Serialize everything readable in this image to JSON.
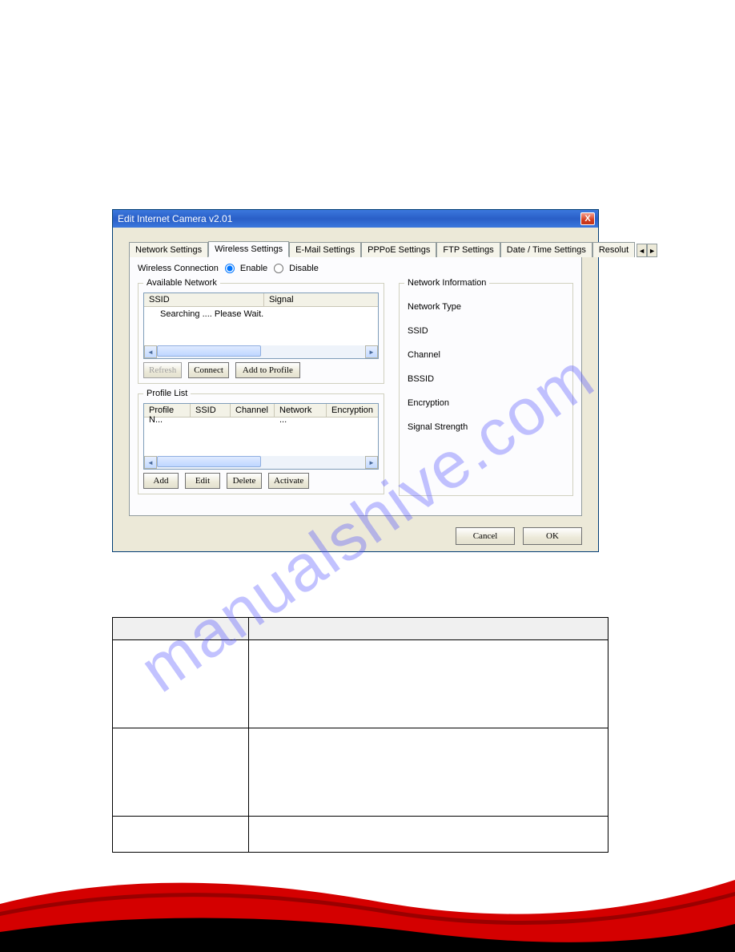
{
  "dialog": {
    "title": "Edit Internet Camera v2.01",
    "close": "X",
    "tabs": [
      "Network Settings",
      "Wireless Settings",
      "E-Mail Settings",
      "PPPoE Settings",
      "FTP Settings",
      "Date / Time Settings",
      "Resolut"
    ],
    "activeTab": 1,
    "tab_arrow_left": "◄",
    "tab_arrow_right": "►"
  },
  "wireless": {
    "label": "Wireless Connection",
    "enable": "Enable",
    "disable": "Disable"
  },
  "available": {
    "legend": "Available Network",
    "cols": [
      "SSID",
      "Signal"
    ],
    "status": "Searching .... Please Wait.",
    "btn_refresh": "Refresh",
    "btn_connect": "Connect",
    "btn_add": "Add to Profile"
  },
  "profile": {
    "legend": "Profile List",
    "cols": [
      "Profile N...",
      "SSID",
      "Channel",
      "Network ...",
      "Encryption"
    ],
    "btn_add": "Add",
    "btn_edit": "Edit",
    "btn_delete": "Delete",
    "btn_activate": "Activate"
  },
  "info": {
    "legend": "Network Information",
    "rows": [
      "Network Type",
      "SSID",
      "Channel",
      "BSSID",
      "Encryption",
      "Signal Strength"
    ]
  },
  "footer_buttons": {
    "cancel": "Cancel",
    "ok": "OK"
  },
  "scroll": {
    "left": "◄",
    "right": "►"
  },
  "watermark": "manualshive.com"
}
